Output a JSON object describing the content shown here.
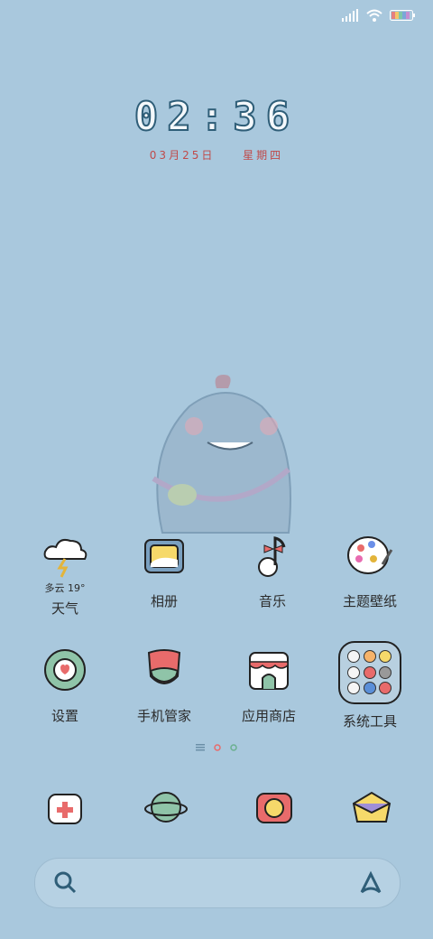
{
  "status": {
    "signal": "signal-icon",
    "wifi": "wifi-icon",
    "battery": "battery-icon"
  },
  "clock": {
    "time": "02:36"
  },
  "date": {
    "month_day": "03月25日",
    "weekday": "星期四"
  },
  "weather": {
    "desc_temp": "多云 19°"
  },
  "apps_row1": [
    {
      "label": "天气",
      "icon": "cloud-lightning-icon"
    },
    {
      "label": "相册",
      "icon": "photo-frame-icon"
    },
    {
      "label": "音乐",
      "icon": "music-note-icon"
    },
    {
      "label": "主题壁纸",
      "icon": "palette-icon"
    }
  ],
  "apps_row2": [
    {
      "label": "设置",
      "icon": "gear-icon"
    },
    {
      "label": "手机管家",
      "icon": "shield-icon"
    },
    {
      "label": "应用商店",
      "icon": "store-icon"
    },
    {
      "label": "系统工具",
      "icon": "folder-icon"
    }
  ],
  "dock": [
    {
      "icon": "medical-kit-icon"
    },
    {
      "icon": "planet-icon"
    },
    {
      "icon": "camera-icon"
    },
    {
      "icon": "mail-icon"
    }
  ],
  "search": {
    "icon": "search-icon",
    "assistant": "assistant-icon"
  }
}
